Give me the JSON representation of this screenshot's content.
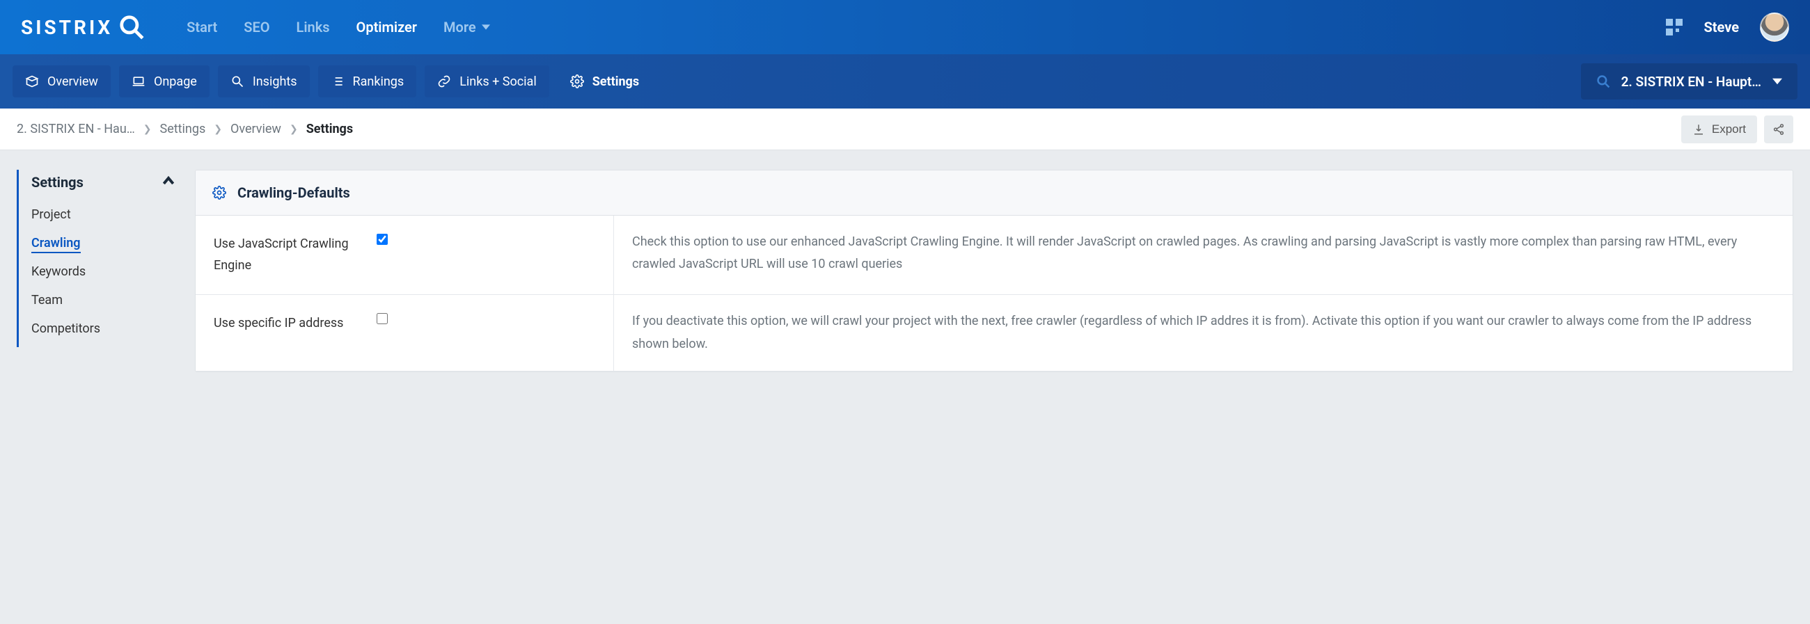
{
  "brand": "SISTRIX",
  "topnav": {
    "start": "Start",
    "seo": "SEO",
    "links": "Links",
    "optimizer": "Optimizer",
    "more": "More"
  },
  "user": {
    "name": "Steve"
  },
  "tabs": {
    "overview": "Overview",
    "onpage": "Onpage",
    "insights": "Insights",
    "rankings": "Rankings",
    "linksSocial": "Links + Social",
    "settings": "Settings"
  },
  "projectPicker": {
    "label": "2. SISTRIX EN - Haupt…"
  },
  "breadcrumb": {
    "items": [
      "2. SISTRIX EN - Hau…",
      "Settings",
      "Overview"
    ],
    "current": "Settings",
    "export": "Export"
  },
  "sidenav": {
    "title": "Settings",
    "items": [
      "Project",
      "Crawling",
      "Keywords",
      "Team",
      "Competitors"
    ],
    "activeIndex": 1
  },
  "panel": {
    "title": "Crawling-Defaults",
    "rows": [
      {
        "label": "Use JavaScript Crawling Engine",
        "checked": true,
        "desc": "Check this option to use our enhanced JavaScript Crawling Engine. It will render JavaScript on crawled pages. As crawling and parsing JavaScript is vastly more complex than parsing raw HTML, every crawled JavaScript URL will use 10 crawl queries"
      },
      {
        "label": "Use specific IP address",
        "checked": false,
        "desc": "If you deactivate this option, we will crawl your project with the next, free crawler (regardless of which IP addres it is from). Activate this option if you want our crawler to always come from the IP address shown below."
      }
    ]
  }
}
